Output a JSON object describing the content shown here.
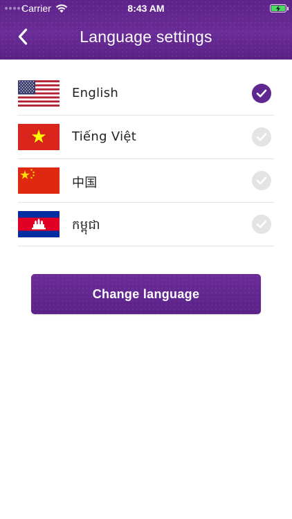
{
  "status_bar": {
    "carrier": "Carrier",
    "time": "8:43 AM",
    "icons": [
      "signal-dots-icon",
      "wifi-icon",
      "battery-charging-icon"
    ]
  },
  "header": {
    "title": "Language settings",
    "back_icon": "chevron-left-icon",
    "background_color": "#62268f"
  },
  "languages": [
    {
      "label": "English",
      "flag": "us-flag-icon",
      "selected": true
    },
    {
      "label": "Tiếng Việt",
      "flag": "vietnam-flag-icon",
      "selected": false
    },
    {
      "label": "中国",
      "flag": "china-flag-icon",
      "selected": false
    },
    {
      "label": "កម្ពុជា",
      "flag": "cambodia-flag-icon",
      "selected": false
    }
  ],
  "action": {
    "change_label": "Change language"
  },
  "colors": {
    "accent": "#5f2790",
    "check_inactive": "#e4e4e4",
    "divider": "#e2e2e2"
  }
}
